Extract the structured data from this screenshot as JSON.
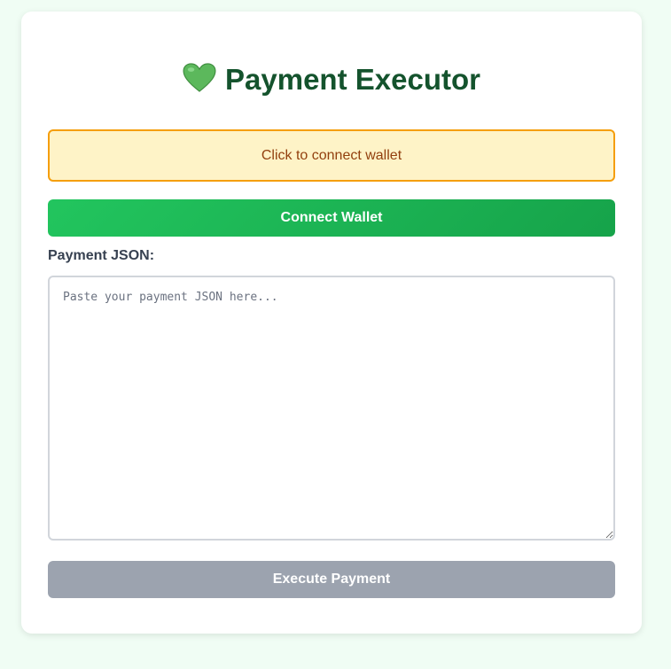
{
  "header": {
    "title": "Payment Executor",
    "icon": "green-heart-icon"
  },
  "status": {
    "message": "Click to connect wallet"
  },
  "wallet": {
    "connect_label": "Connect Wallet"
  },
  "payment": {
    "json_label": "Payment JSON:",
    "json_placeholder": "Paste your payment JSON here...",
    "json_value": "",
    "execute_label": "Execute Payment",
    "execute_enabled": false
  },
  "colors": {
    "page_background": "#f0fdf4",
    "title": "#14532d",
    "accent_green": "#22c55e",
    "status_background": "#fef3c7",
    "status_border": "#f59e0b",
    "status_text": "#92400e",
    "disabled_button": "#9ca3af"
  }
}
